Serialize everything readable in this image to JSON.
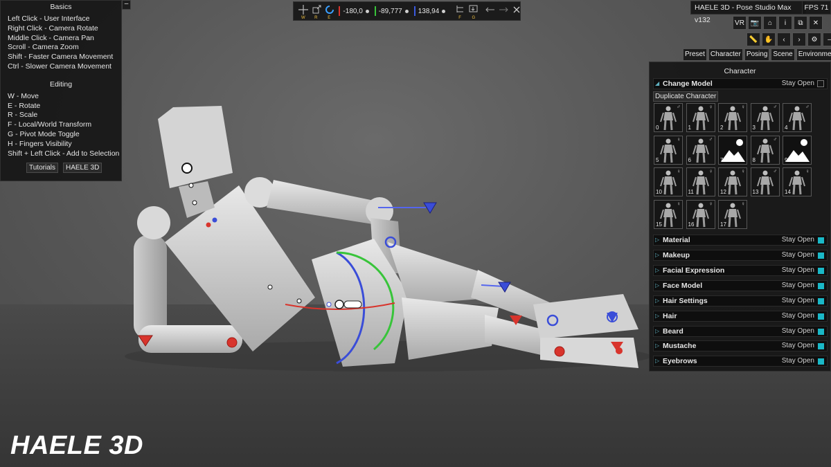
{
  "help": {
    "basics_title": "Basics",
    "basics": [
      "Left Click - User Interface",
      "Right Click - Camera Rotate",
      "Middle Click - Camera Pan",
      "Scroll - Camera Zoom",
      "Shift - Faster Camera Movement",
      "Ctrl - Slower Camera Movement"
    ],
    "editing_title": "Editing",
    "editing": [
      "W - Move",
      "E - Rotate",
      "R - Scale",
      "F - Local/World Transform",
      "G - Pivot Mode Toggle",
      "H - Fingers Visibility",
      "Shift + Left Click - Add to Selection"
    ],
    "tutorials_label": "Tutorials",
    "haele_label": "HAELE 3D",
    "collapse_label": "–"
  },
  "toolbar": {
    "keys": {
      "move": "W",
      "scale": "R",
      "rotate": "E",
      "local": "F",
      "pivot": "G"
    },
    "coord_x": "-180,0",
    "coord_y": "-89,777",
    "coord_z": "138,94",
    "colors": {
      "x": "#d8342c",
      "y": "#38c43a",
      "z": "#3a5ae0"
    }
  },
  "app": {
    "title": "HAELE 3D - Pose Studio Max v132",
    "fps": "FPS 71"
  },
  "icon_row1": [
    {
      "name": "vr-button",
      "label": "VR"
    },
    {
      "name": "camera-icon",
      "label": "📷"
    },
    {
      "name": "home-icon",
      "label": "⌂"
    },
    {
      "name": "info-icon",
      "label": "i"
    },
    {
      "name": "copy-icon",
      "label": "⧉"
    },
    {
      "name": "close-icon",
      "label": "✕"
    }
  ],
  "icon_row2": [
    {
      "name": "ruler-icon",
      "label": "📏"
    },
    {
      "name": "hand-icon",
      "label": "✋"
    },
    {
      "name": "chevron-left-icon",
      "label": "‹"
    },
    {
      "name": "chevron-right-icon",
      "label": "›"
    },
    {
      "name": "gear-icon",
      "label": "⚙"
    },
    {
      "name": "minimize-icon",
      "label": "–"
    }
  ],
  "tabs": [
    "Preset",
    "Character",
    "Posing",
    "Scene",
    "Environment"
  ],
  "character_panel": {
    "title": "Character",
    "change_model": "Change Model",
    "stay_open": "Stay Open",
    "duplicate": "Duplicate Character",
    "models": [
      {
        "num": "0",
        "sex": "♂"
      },
      {
        "num": "1",
        "sex": "♀"
      },
      {
        "num": "2",
        "sex": "♀"
      },
      {
        "num": "3",
        "sex": "♂"
      },
      {
        "num": "4",
        "sex": "♂"
      },
      {
        "num": "5",
        "sex": "♀"
      },
      {
        "num": "6",
        "sex": "♂"
      },
      {
        "num": "7",
        "sex": ""
      },
      {
        "num": "8",
        "sex": "♂"
      },
      {
        "num": "9",
        "sex": ""
      },
      {
        "num": "10",
        "sex": "♀"
      },
      {
        "num": "11",
        "sex": "♀"
      },
      {
        "num": "12",
        "sex": "♀"
      },
      {
        "num": "13",
        "sex": "♂"
      },
      {
        "num": "14",
        "sex": "♀"
      },
      {
        "num": "15",
        "sex": "♀"
      },
      {
        "num": "16",
        "sex": "♀"
      },
      {
        "num": "17",
        "sex": "♀"
      }
    ],
    "sections": [
      "Material",
      "Makeup",
      "Facial Expression",
      "Face Model",
      "Hair Settings",
      "Hair",
      "Beard",
      "Mustache",
      "Eyebrows"
    ]
  },
  "logo": "HAELE 3D"
}
